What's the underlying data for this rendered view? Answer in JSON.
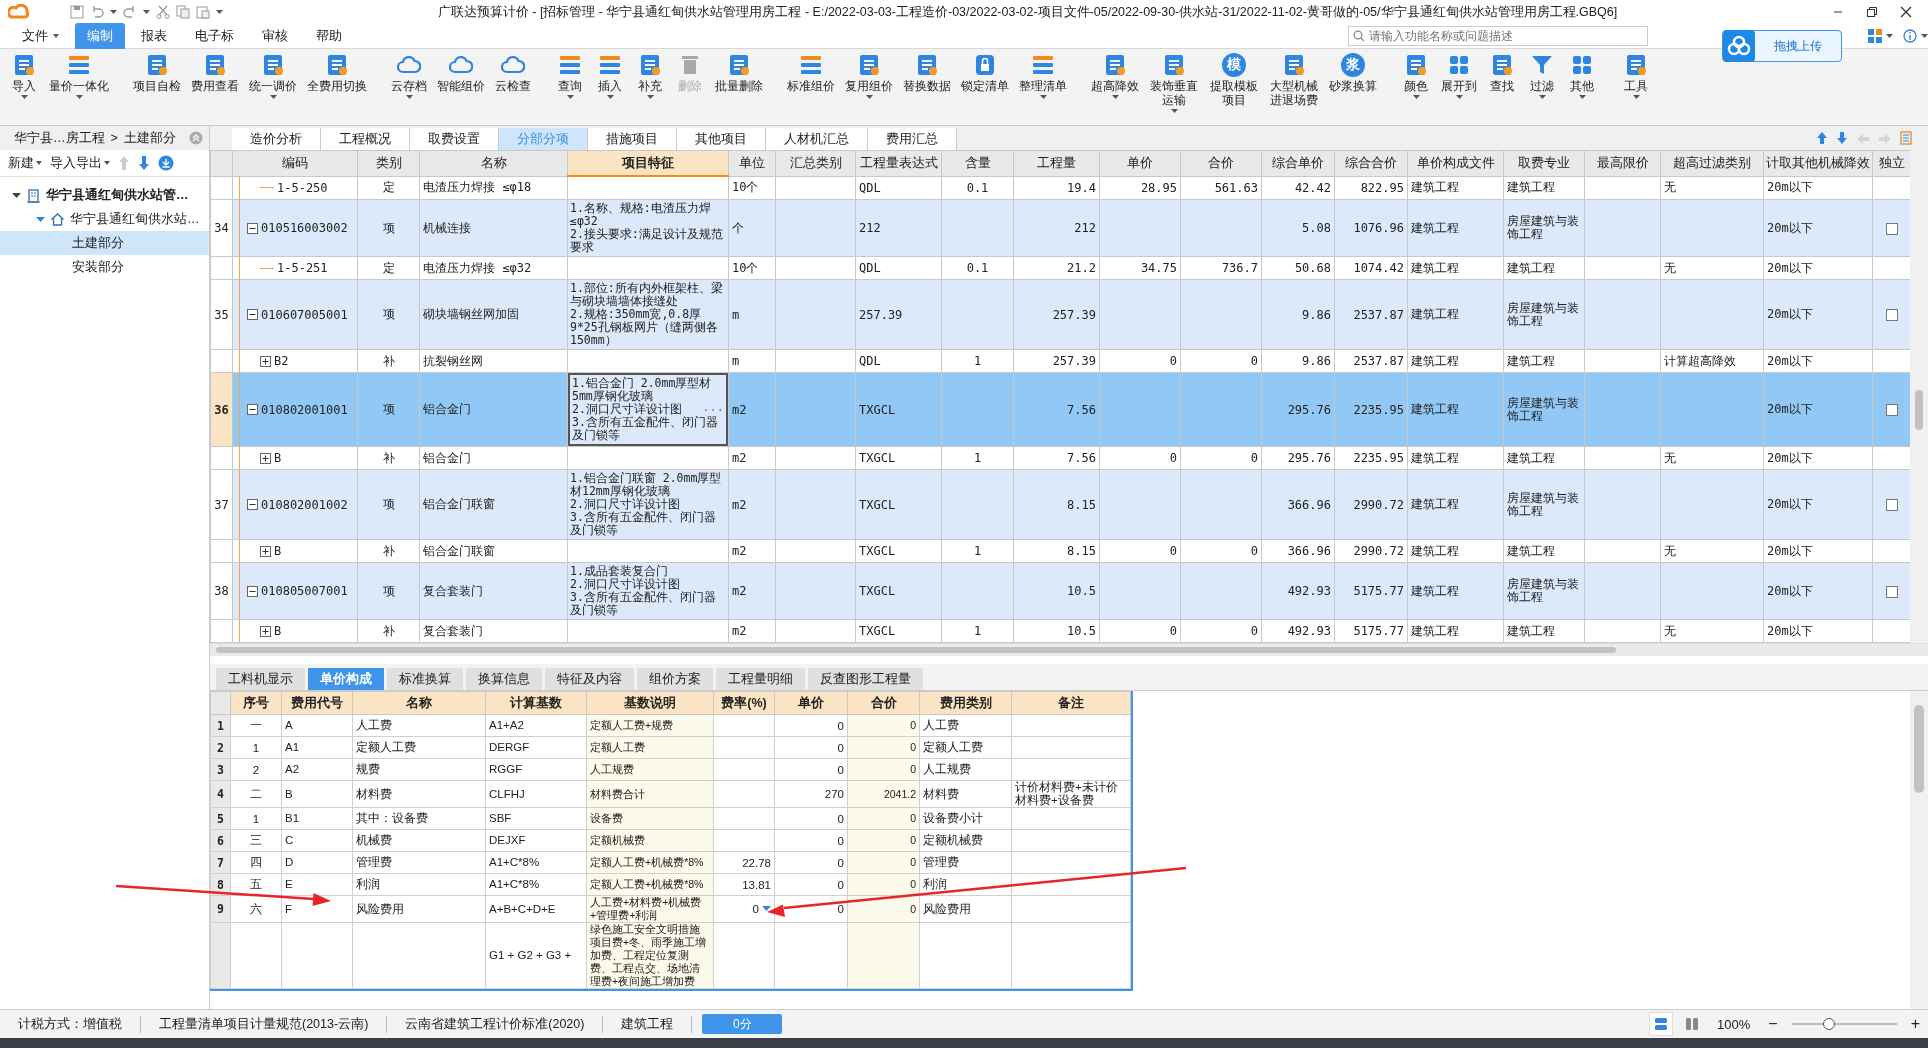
{
  "window": {
    "title": "广联达预算计价 - [招标管理 - 华宁县通红甸供水站管理用房工程 - E:/2022-03-03-工程造价-03/2022-03-02-项目文件-05/2022-09-30-供水站-31/2022-11-02-黄哥做的-05/华宁县通红甸供水站管理用房工程.GBQ6]"
  },
  "menu": [
    {
      "label": "文件",
      "selected": false,
      "dropdown": true
    },
    {
      "label": "编制",
      "selected": true,
      "dropdown": false
    },
    {
      "label": "报表",
      "selected": false,
      "dropdown": false
    },
    {
      "label": "电子标",
      "selected": false,
      "dropdown": false
    },
    {
      "label": "审核",
      "selected": false,
      "dropdown": false
    },
    {
      "label": "帮助",
      "selected": false,
      "dropdown": false
    }
  ],
  "search": {
    "placeholder": "请输入功能名称或问题描述"
  },
  "upload": {
    "label": "拖拽上传"
  },
  "toolbar": {
    "groups": [
      {
        "buttons": [
          {
            "label": "导入",
            "dropdown": true,
            "disabled": false
          },
          {
            "label": "量价一体化",
            "dropdown": true,
            "disabled": false
          }
        ]
      },
      {
        "buttons": [
          {
            "label": "项目自检",
            "dropdown": false,
            "disabled": false
          },
          {
            "label": "费用查看",
            "dropdown": false,
            "disabled": false
          },
          {
            "label": "统一调价",
            "dropdown": true,
            "disabled": false
          },
          {
            "label": "全费用切换",
            "dropdown": false,
            "disabled": false
          }
        ]
      },
      {
        "buttons": [
          {
            "label": "云存档",
            "dropdown": true,
            "disabled": false
          },
          {
            "label": "智能组价",
            "dropdown": false,
            "disabled": false
          },
          {
            "label": "云检查",
            "dropdown": false,
            "disabled": false
          }
        ]
      },
      {
        "buttons": [
          {
            "label": "查询",
            "dropdown": true,
            "disabled": false
          },
          {
            "label": "插入",
            "dropdown": true,
            "disabled": false
          },
          {
            "label": "补充",
            "dropdown": true,
            "disabled": false
          },
          {
            "label": "删除",
            "dropdown": false,
            "disabled": true
          },
          {
            "label": "批量删除",
            "dropdown": false,
            "disabled": false
          }
        ]
      },
      {
        "buttons": [
          {
            "label": "标准组价",
            "dropdown": false,
            "disabled": false
          },
          {
            "label": "复用组价",
            "dropdown": true,
            "disabled": false
          },
          {
            "label": "替换数据",
            "dropdown": false,
            "disabled": false
          },
          {
            "label": "锁定清单",
            "dropdown": false,
            "disabled": false
          },
          {
            "label": "整理清单",
            "dropdown": true,
            "disabled": false
          }
        ]
      },
      {
        "buttons": [
          {
            "label": "超高降效",
            "dropdown": true,
            "disabled": false
          },
          {
            "label": "装饰垂直运输",
            "dropdown": true,
            "disabled": false
          },
          {
            "label": "提取模板项目",
            "glyph": "模",
            "dropdown": false,
            "disabled": false
          },
          {
            "label": "大型机械进退场费",
            "dropdown": false,
            "disabled": false
          },
          {
            "label": "砂浆换算",
            "glyph": "浆",
            "dropdown": false,
            "disabled": false
          }
        ]
      },
      {
        "buttons": [
          {
            "label": "颜色",
            "dropdown": true,
            "disabled": false
          },
          {
            "label": "展开到",
            "dropdown": true,
            "disabled": false
          },
          {
            "label": "查找",
            "dropdown": false,
            "disabled": false
          },
          {
            "label": "过滤",
            "dropdown": true,
            "disabled": false
          },
          {
            "label": "其他",
            "dropdown": true,
            "disabled": false
          }
        ]
      },
      {
        "buttons": [
          {
            "label": "工具",
            "dropdown": true,
            "disabled": false
          }
        ]
      }
    ]
  },
  "sidebar": {
    "breadcrumb": [
      "华宁县…房工程",
      "土建部分"
    ],
    "separator": ">",
    "actions": [
      {
        "label": "新建",
        "dropdown": true
      },
      {
        "label": "导入导出",
        "dropdown": true
      }
    ],
    "tree": [
      {
        "label": "华宁县通红甸供水站管…",
        "expanded": true,
        "selected": false,
        "children": [
          {
            "label": "华宁县通红甸供水站…",
            "expanded": true,
            "selected": false,
            "children": [
              {
                "label": "土建部分",
                "selected": true
              },
              {
                "label": "安装部分",
                "selected": false
              }
            ]
          }
        ]
      }
    ]
  },
  "tabs": [
    {
      "label": "造价分析",
      "selected": false
    },
    {
      "label": "工程概况",
      "selected": false
    },
    {
      "label": "取费设置",
      "selected": false
    },
    {
      "label": "分部分项",
      "selected": true
    },
    {
      "label": "措施项目",
      "selected": false
    },
    {
      "label": "其他项目",
      "selected": false
    },
    {
      "label": "人材机汇总",
      "selected": false
    },
    {
      "label": "费用汇总",
      "selected": false
    }
  ],
  "table": {
    "columns": [
      {
        "label": "编码",
        "selected": false
      },
      {
        "label": "类别",
        "selected": false
      },
      {
        "label": "名称",
        "selected": false
      },
      {
        "label": "项目特征",
        "selected": true
      },
      {
        "label": "单位",
        "selected": false
      },
      {
        "label": "汇总类别",
        "selected": false
      },
      {
        "label": "工程量表达式",
        "selected": false
      },
      {
        "label": "含量",
        "selected": false
      },
      {
        "label": "工程量",
        "selected": false
      },
      {
        "label": "单价",
        "selected": false
      },
      {
        "label": "合价",
        "selected": false
      },
      {
        "label": "综合单价",
        "selected": false
      },
      {
        "label": "综合合价",
        "selected": false
      },
      {
        "label": "单价构成文件",
        "selected": false
      },
      {
        "label": "取费专业",
        "selected": false
      },
      {
        "label": "最高限价",
        "selected": false
      },
      {
        "label": "超高过滤类别",
        "selected": false
      },
      {
        "label": "计取其他机械降效",
        "selected": false
      },
      {
        "label": "独立",
        "selected": false
      }
    ],
    "rows": [
      {
        "kind": "sub",
        "selected": false,
        "code": "1-5-250",
        "type": "定",
        "name": "电渣压力焊接 ≤φ18",
        "unit": "10个",
        "expr": "QDL",
        "content": "0.1",
        "qty": "19.4",
        "price": "28.95",
        "total": "561.63",
        "uprice": "42.42",
        "utotal": "822.95",
        "file": "建筑工程",
        "specialty": "建筑工程",
        "filter": "无",
        "mech": "20m以下"
      },
      {
        "kind": "item",
        "number": "34",
        "selected": false,
        "expanded": true,
        "code": "010516003002",
        "type": "项",
        "name": "机械连接",
        "feature": "1.名称、规格:电渣压力焊≤φ32\n2.接头要求:满足设计及规范要求",
        "unit": "个",
        "expr": "212",
        "qty": "212",
        "uprice": "5.08",
        "utotal": "1076.96",
        "file": "建筑工程",
        "specialty": "房屋建筑与装饰工程",
        "mech": "20m以下",
        "independent": false
      },
      {
        "kind": "sub",
        "selected": false,
        "code": "1-5-251",
        "type": "定",
        "name": "电渣压力焊接 ≤φ32",
        "unit": "10个",
        "expr": "QDL",
        "content": "0.1",
        "qty": "21.2",
        "price": "34.75",
        "total": "736.7",
        "uprice": "50.68",
        "utotal": "1074.42",
        "file": "建筑工程",
        "specialty": "建筑工程",
        "filter": "无",
        "mech": "20m以下"
      },
      {
        "kind": "item",
        "number": "35",
        "selected": false,
        "expanded": true,
        "code": "010607005001",
        "type": "项",
        "name": "砌块墙钢丝网加固",
        "feature": "1.部位:所有内外框架柱、梁与砌块墙墙体接缝处\n2.规格:350mm宽,0.8厚9*25孔钢板网片（缝两侧各150mm）",
        "unit": "m",
        "expr": "257.39",
        "qty": "257.39",
        "uprice": "9.86",
        "utotal": "2537.87",
        "file": "建筑工程",
        "specialty": "房屋建筑与装饰工程",
        "mech": "20m以下",
        "independent": false
      },
      {
        "kind": "sub",
        "selected": false,
        "expanded": false,
        "code": "B2",
        "type": "补",
        "name": "抗裂钢丝网",
        "unit": "m",
        "expr": "QDL",
        "content": "1",
        "qty": "257.39",
        "price": "0",
        "total": "0",
        "uprice": "9.86",
        "utotal": "2537.87",
        "file": "建筑工程",
        "specialty": "建筑工程",
        "filter": "计算超高降效",
        "mech": "20m以下"
      },
      {
        "kind": "item",
        "number": "36",
        "selected": true,
        "expanded": true,
        "code": "010802001001",
        "type": "项",
        "name": "铝合金门",
        "feature": "1.铝合金门 2.0mm厚型材5mm厚钢化玻璃\n2.洞口尺寸详设计图\n3.含所有五金配件、闭门器及门锁等",
        "edit_button": "···",
        "unit": "m2",
        "expr": "TXGCL",
        "qty": "7.56",
        "uprice": "295.76",
        "utotal": "2235.95",
        "file": "建筑工程",
        "specialty": "房屋建筑与装饰工程",
        "mech": "20m以下",
        "independent": false
      },
      {
        "kind": "sub",
        "selected": false,
        "expanded": false,
        "code": "B",
        "type": "补",
        "name": "铝合金门",
        "unit": "m2",
        "expr": "TXGCL",
        "content": "1",
        "qty": "7.56",
        "price": "0",
        "total": "0",
        "uprice": "295.76",
        "utotal": "2235.95",
        "file": "建筑工程",
        "specialty": "建筑工程",
        "filter": "无",
        "mech": "20m以下"
      },
      {
        "kind": "item",
        "number": "37",
        "selected": false,
        "expanded": true,
        "code": "010802001002",
        "type": "项",
        "name": "铝合金门联窗",
        "feature": "1.铝合金门联窗 2.0mm厚型材12mm厚钢化玻璃\n2.洞口尺寸详设计图\n3.含所有五金配件、闭门器及门锁等",
        "unit": "m2",
        "expr": "TXGCL",
        "qty": "8.15",
        "uprice": "366.96",
        "utotal": "2990.72",
        "file": "建筑工程",
        "specialty": "房屋建筑与装饰工程",
        "mech": "20m以下",
        "independent": false
      },
      {
        "kind": "sub",
        "selected": false,
        "expanded": false,
        "code": "B",
        "type": "补",
        "name": "铝合金门联窗",
        "unit": "m2",
        "expr": "TXGCL",
        "content": "1",
        "qty": "8.15",
        "price": "0",
        "total": "0",
        "uprice": "366.96",
        "utotal": "2990.72",
        "file": "建筑工程",
        "specialty": "建筑工程",
        "filter": "无",
        "mech": "20m以下"
      },
      {
        "kind": "item",
        "number": "38",
        "selected": false,
        "expanded": true,
        "code": "010805007001",
        "type": "项",
        "name": "复合套装门",
        "feature": "1.成品套装复合门\n2.洞口尺寸详设计图\n3.含所有五金配件、闭门器及门锁等",
        "unit": "m2",
        "expr": "TXGCL",
        "qty": "10.5",
        "uprice": "492.93",
        "utotal": "5175.77",
        "file": "建筑工程",
        "specialty": "房屋建筑与装饰工程",
        "mech": "20m以下",
        "independent": false
      },
      {
        "kind": "sub",
        "selected": false,
        "expanded": false,
        "code": "B",
        "type": "补",
        "name": "复合套装门",
        "unit": "m2",
        "expr": "TXGCL",
        "content": "1",
        "qty": "10.5",
        "price": "0",
        "total": "0",
        "uprice": "492.93",
        "utotal": "5175.77",
        "file": "建筑工程",
        "specialty": "建筑工程",
        "filter": "无",
        "mech": "20m以下"
      }
    ]
  },
  "detail_tabs": [
    {
      "label": "工料机显示",
      "selected": false
    },
    {
      "label": "单价构成",
      "selected": true
    },
    {
      "label": "标准换算",
      "selected": false
    },
    {
      "label": "换算信息",
      "selected": false
    },
    {
      "label": "特征及内容",
      "selected": false
    },
    {
      "label": "组价方案",
      "selected": false
    },
    {
      "label": "工程量明细",
      "selected": false
    },
    {
      "label": "反查图形工程量",
      "selected": false
    }
  ],
  "detail_table": {
    "columns": [
      "序号",
      "费用代号",
      "名称",
      "计算基数",
      "基数说明",
      "费率(%)",
      "单价",
      "合价",
      "费用类别",
      "备注"
    ],
    "rows": [
      {
        "number": "1",
        "seq": "一",
        "code": "A",
        "name": "人工费",
        "base": "A1+A2",
        "desc": "定额人工费+规费",
        "price": "0",
        "total": "0",
        "category": "人工费"
      },
      {
        "number": "2",
        "seq": "1",
        "code": "A1",
        "name": "定额人工费",
        "base": "DERGF",
        "desc": "定额人工费",
        "price": "0",
        "total": "0",
        "category": "定额人工费"
      },
      {
        "number": "3",
        "seq": "2",
        "code": "A2",
        "name": "规费",
        "base": "RGGF",
        "desc": "人工规费",
        "price": "0",
        "total": "0",
        "category": "人工规费"
      },
      {
        "number": "4",
        "seq": "二",
        "code": "B",
        "name": "材料费",
        "base": "CLFHJ",
        "desc": "材料费合计",
        "price": "270",
        "total": "2041.2",
        "category": "材料费",
        "note": "计价材料费+未计价材料费+设备费"
      },
      {
        "number": "5",
        "seq": "1",
        "code": "B1",
        "name": "其中：设备费",
        "base": "SBF",
        "desc": "设备费",
        "price": "0",
        "total": "0",
        "category": "设备费小计"
      },
      {
        "number": "6",
        "seq": "三",
        "code": "C",
        "name": "机械费",
        "base": "DEJXF",
        "desc": "定额机械费",
        "price": "0",
        "total": "0",
        "category": "定额机械费"
      },
      {
        "number": "7",
        "seq": "四",
        "code": "D",
        "name": "管理费",
        "base": "A1+C*8%",
        "desc": "定额人工费+机械费*8%",
        "rate": "22.78",
        "price": "0",
        "total": "0",
        "category": "管理费"
      },
      {
        "number": "8",
        "seq": "五",
        "code": "E",
        "name": "利润",
        "base": "A1+C*8%",
        "desc": "定额人工费+机械费*8%",
        "rate": "13.81",
        "price": "0",
        "total": "0",
        "category": "利润"
      },
      {
        "number": "9",
        "seq": "六",
        "code": "F",
        "name": "风险费用",
        "base": "A+B+C+D+E",
        "desc": "人工费+材料费+机械费+管理费+利润",
        "rate": "0",
        "rate_dropdown": true,
        "price": "0",
        "total": "0",
        "category": "风险费用"
      },
      {
        "base": "G1 + G2 + G3 +",
        "desc": "绿色施工安全文明措施项目费+冬、雨季施工增加费、工程定位复测费、工程点交、场地清理费+夜间施工增加费"
      }
    ]
  },
  "annotations": [
    {
      "kind": "arrow"
    },
    {
      "kind": "arrow"
    }
  ],
  "status_bar": {
    "items": [
      "计税方式：增值税",
      "工程量清单项目计量规范(2013-云南)",
      "云南省建筑工程计价标准(2020)",
      "建筑工程"
    ],
    "score": "0分",
    "views": [
      {
        "selected": true
      },
      {
        "selected": false
      }
    ],
    "zoom": "100%",
    "zoom_out": "−",
    "zoom_in": "+",
    "zoom_slider": {
      "level": 0.36
    }
  }
}
